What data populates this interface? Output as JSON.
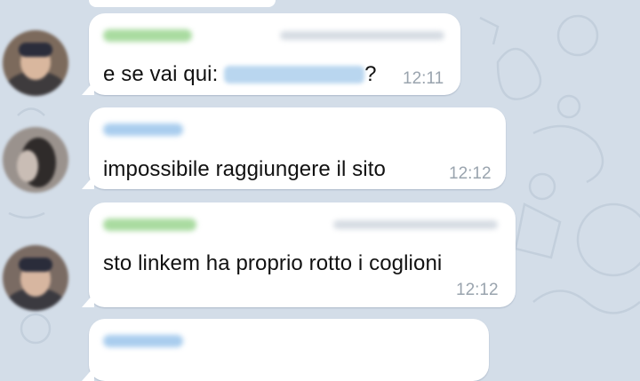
{
  "chat": {
    "messages": [
      {
        "sender_color": "#a9dba0",
        "text_before_link": "e se vai qui: ",
        "text_after_link": "?",
        "time": "12:11"
      },
      {
        "sender_color": "#a9cdee",
        "text": "impossibile raggiungere il sito",
        "time": "12:12"
      },
      {
        "sender_color": "#a9dba0",
        "text": "sto linkem ha proprio rotto i coglioni",
        "time": "12:12"
      },
      {
        "sender_color": "#a9cdee"
      }
    ]
  },
  "colors": {
    "background": "#d3dde8",
    "bubble": "#ffffff",
    "timestamp": "#9aa4ae",
    "link_blur": "#b9d6ef"
  },
  "icons": [
    "avatar-person",
    "avatar-person",
    "avatar-person"
  ]
}
